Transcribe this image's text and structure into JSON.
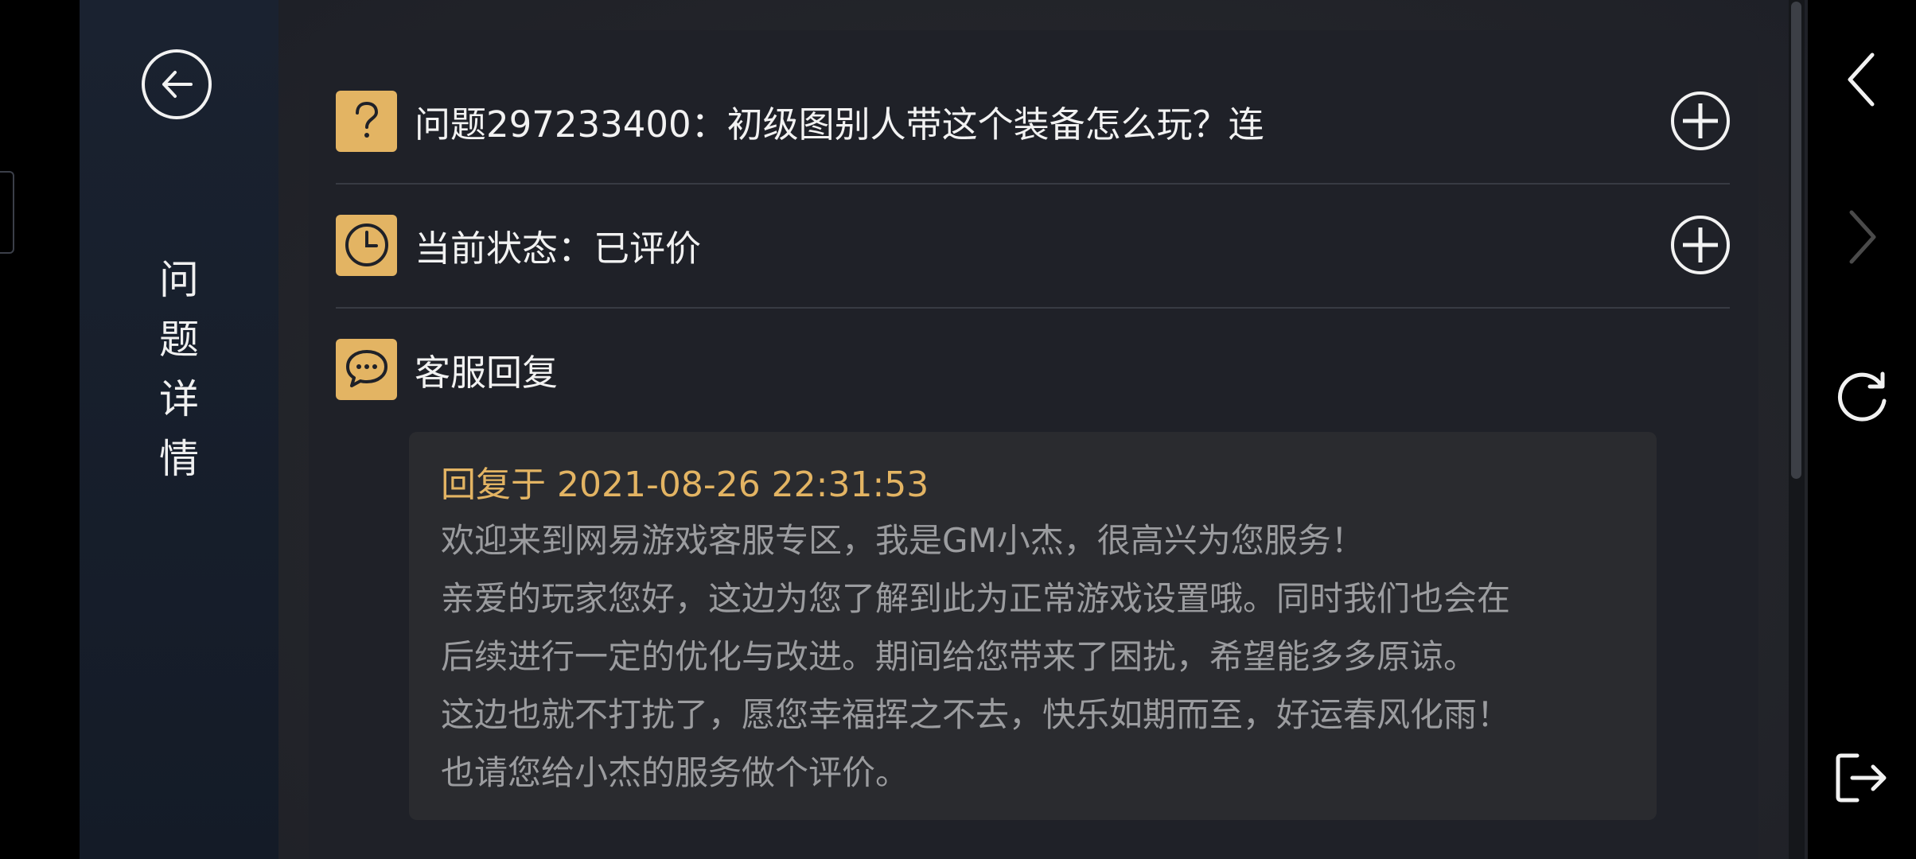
{
  "sidebar": {
    "title_chars": [
      "问",
      "题",
      "详",
      "情"
    ]
  },
  "question": {
    "text": "问题297233400：初级图别人带这个装备怎么玩？连"
  },
  "status": {
    "text": "当前状态：已评价"
  },
  "reply_section": {
    "label": "客服回复"
  },
  "reply": {
    "time": "回复于 2021-08-26 22:31:53",
    "lines": [
      "欢迎来到网易游戏客服专区，我是GM小杰，很高兴为您服务！",
      "亲爱的玩家您好，这边为您了解到此为正常游戏设置哦。同时我们也会在",
      "后续进行一定的优化与改进。期间给您带来了困扰，希望能多多原谅。",
      "这边也就不打扰了，愿您幸福挥之不去，快乐如期而至，好运春风化雨！",
      "也请您给小杰的服务做个评价。"
    ]
  },
  "icons": {
    "back": "arrow-left-circle-icon",
    "question": "question-mark-icon",
    "clock": "clock-icon",
    "chat": "chat-bubble-icon",
    "expand": "plus-circle-icon",
    "nav_back": "chevron-left-icon",
    "nav_forward": "chevron-right-icon",
    "refresh": "refresh-icon",
    "exit": "exit-icon"
  },
  "colors": {
    "accent": "#e3b463",
    "text_primary": "#f2f2f2",
    "text_secondary": "#9b9c9f",
    "sidebar_bg": "#1a2230",
    "panel_bg": "#1f2128",
    "card_bg": "#2a2b2f"
  }
}
